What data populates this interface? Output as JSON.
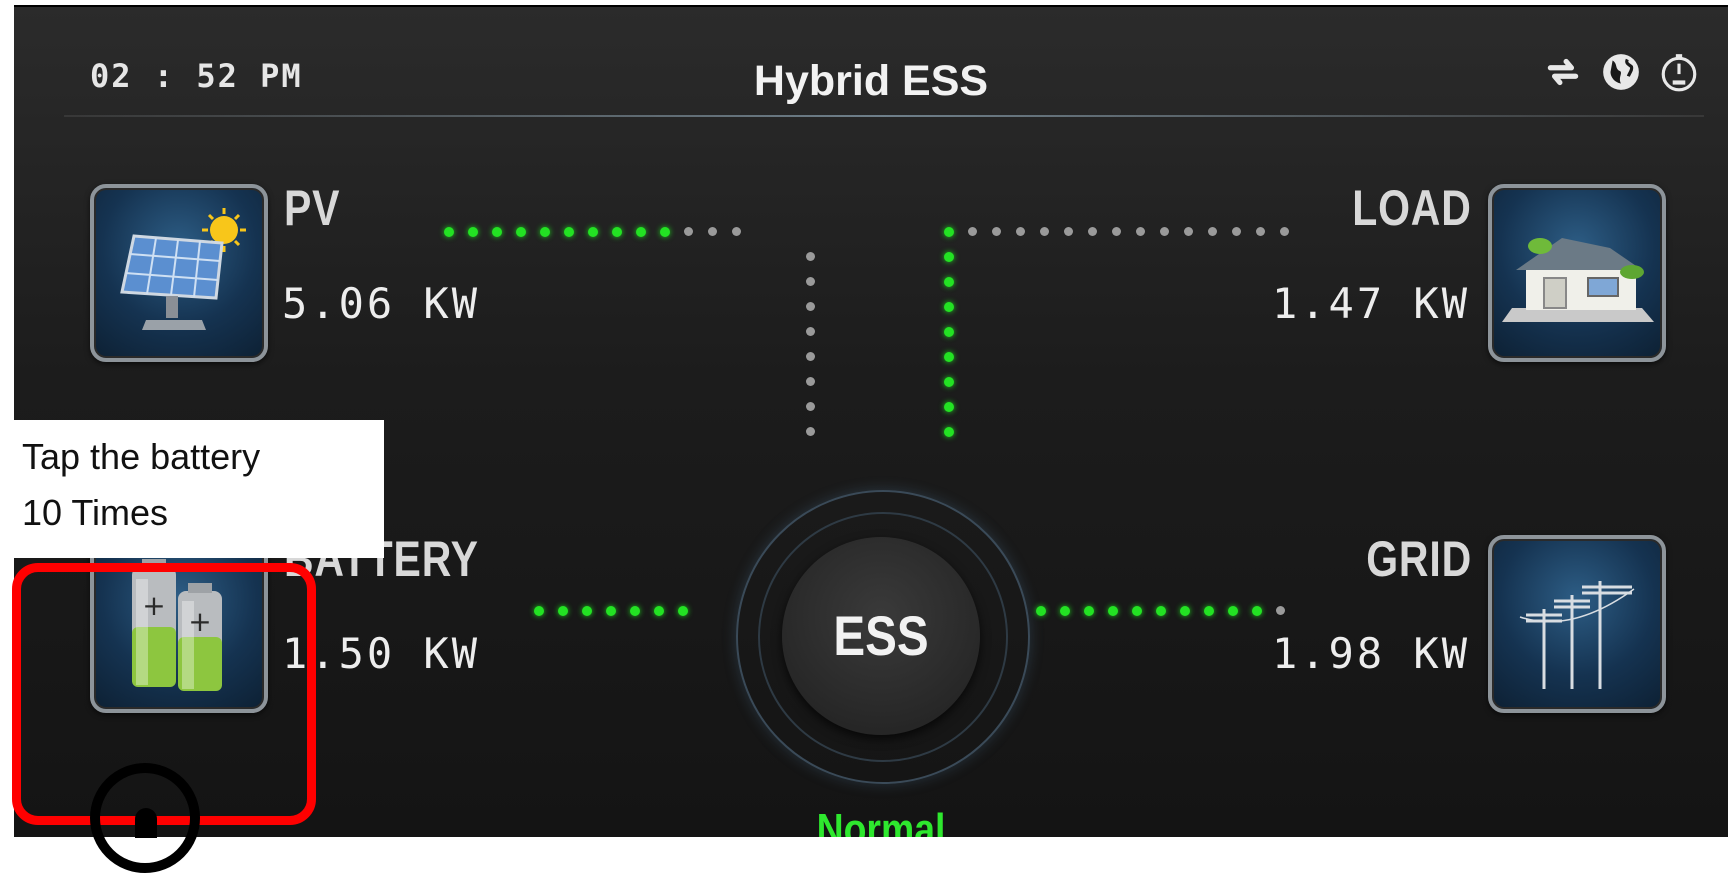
{
  "header": {
    "time": "02 : 52 PM",
    "title": "Hybrid ESS",
    "icons": [
      "refresh-icon",
      "globe-icon",
      "gauge-icon"
    ]
  },
  "pv": {
    "label": "PV",
    "value": "5.06 KW",
    "icon": "solar-panel-icon"
  },
  "load": {
    "label": "LOAD",
    "value": "1.47 KW",
    "icon": "house-icon"
  },
  "battery": {
    "label": "BATTERY",
    "value": "1.50 KW",
    "icon": "battery-icon"
  },
  "grid": {
    "label": "GRID",
    "value": "1.98 KW",
    "icon": "power-pole-icon"
  },
  "center": {
    "label": "ESS",
    "status": "Normal"
  },
  "callout": {
    "line1": "Tap the battery",
    "line2": "10 Times"
  },
  "colors": {
    "flow_active": "#23e223",
    "flow_inactive": "#9a9a9a",
    "status": "#2ee82e",
    "highlight": "#ff0000"
  }
}
